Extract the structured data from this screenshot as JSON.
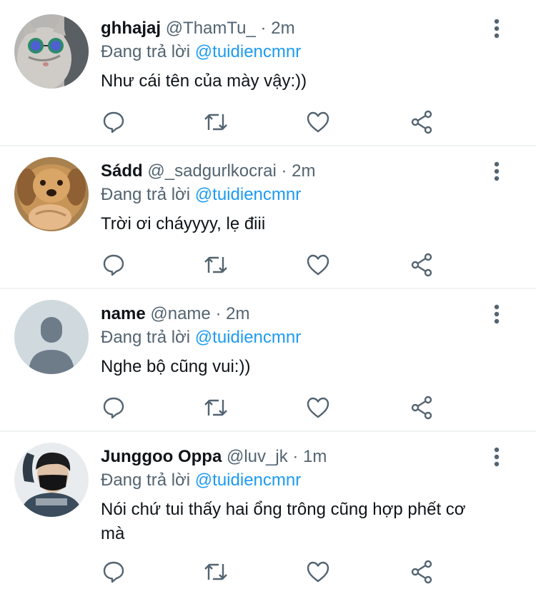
{
  "colors": {
    "name": "#0f1419",
    "meta": "#536471",
    "link": "#1d9bf0",
    "divider": "#eff3f4"
  },
  "replies": [
    {
      "display_name": "ghhajaj",
      "handle": "@ThamTu_",
      "separator": "·",
      "time": "2m",
      "replying_prefix": "Đang trả lời",
      "replying_to": "@tuidiencmnr",
      "text": "Như cái tên của mày vậy:))",
      "avatar": "cat-with-sunglasses-avatar"
    },
    {
      "display_name": "Sádd",
      "handle": "@_sadgurlkocrai",
      "separator": "·",
      "time": "2m",
      "replying_prefix": "Đang trả lời",
      "replying_to": "@tuidiencmnr",
      "text": "Trời ơi cháyyyy, lẹ điii",
      "avatar": "dog-avatar"
    },
    {
      "display_name": "name",
      "handle": "@name",
      "separator": "·",
      "time": "2m",
      "replying_prefix": "Đang trả lời",
      "replying_to": "@tuidiencmnr",
      "text": "Nghe bộ cũng vui:))",
      "avatar": "default-profile-avatar"
    },
    {
      "display_name": "Junggoo Oppa",
      "handle": "@luv_jk",
      "separator": "·",
      "time": "1m",
      "replying_prefix": "Đang trả lời",
      "replying_to": "@tuidiencmnr",
      "text": "Nói chứ tui thấy hai ổng trông cũng hợp phết cơ mà",
      "avatar": "masked-person-avatar"
    }
  ],
  "action_icons": [
    "reply-icon",
    "retweet-icon",
    "like-icon",
    "share-icon"
  ]
}
